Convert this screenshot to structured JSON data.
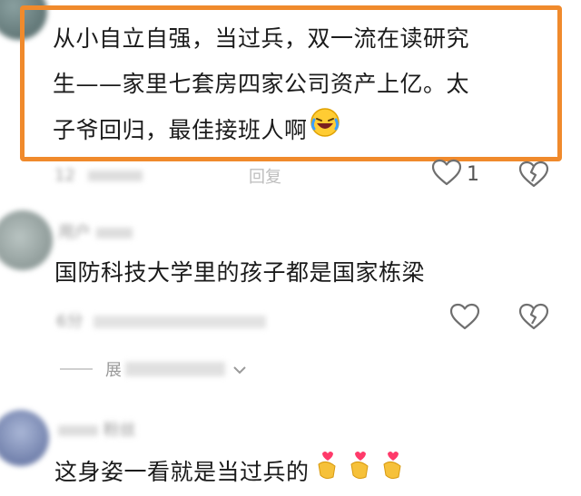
{
  "comments": [
    {
      "text_lines": [
        "从小自立自强，当过兵，双一流在读研究",
        "生——家里七套房四家公司资产上亿。太",
        "子爷回归，最佳接班人啊"
      ],
      "emoji_label": "laughing-crying-emoji",
      "meta_left": "12",
      "meta_reply": "回复",
      "like_count": "1"
    },
    {
      "username": "用户",
      "text": "国防科技大学里的孩子都是国家栋梁",
      "meta": "6分",
      "expand_label": "展"
    },
    {
      "username": "粉丝",
      "text": "这身姿一看就是当过兵的"
    }
  ],
  "colors": {
    "highlight_border": "#f08a2c",
    "meta_text": "#9a9a9a",
    "icon_stroke": "#6f6f6f"
  }
}
